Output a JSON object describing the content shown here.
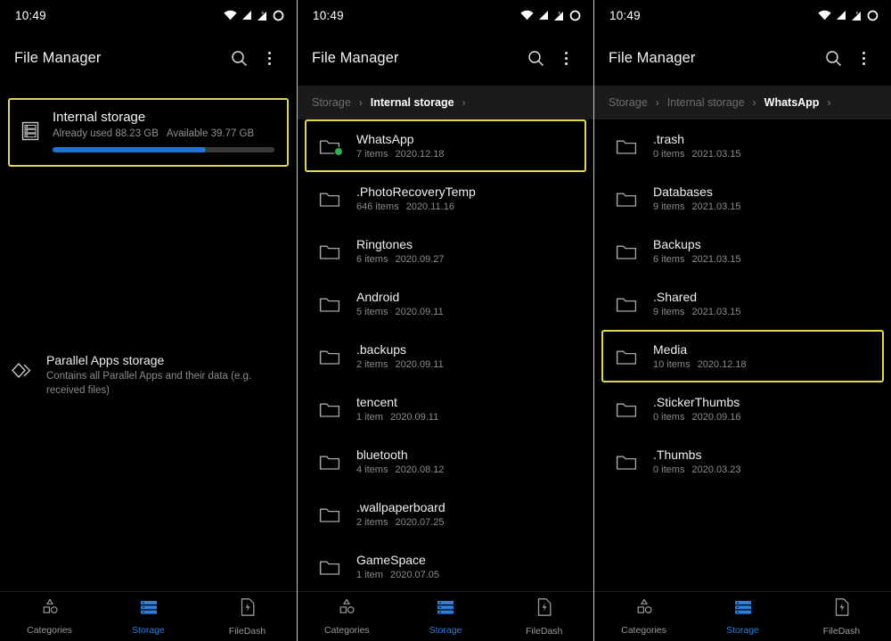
{
  "statusbar": {
    "time": "10:49",
    "icons": [
      "wifi-icon",
      "signal-icon",
      "signal-x-icon",
      "battery-circle-icon"
    ]
  },
  "appbar": {
    "title": "File Manager",
    "search_icon": "search-icon",
    "overflow_icon": "more-vertical-icon"
  },
  "colors": {
    "accent_blue": "#1e74d4",
    "highlight_yellow": "#e2d84e",
    "badge_green": "#2fae54",
    "background": "#000000",
    "breadcrumb_bg": "#1b1b1b"
  },
  "bottom_nav": {
    "items": [
      {
        "label": "Categories",
        "icon": "shapes-icon",
        "active": false
      },
      {
        "label": "Storage",
        "icon": "storage-stack-icon",
        "active": true
      },
      {
        "label": "FileDash",
        "icon": "file-lightning-icon",
        "active": false
      }
    ]
  },
  "panel1": {
    "storage_card": {
      "title": "Internal storage",
      "used_label": "Already used 88.23 GB",
      "available_label": "Available 39.77 GB",
      "progress_percent": 69,
      "icon": "internal-storage-icon",
      "selected": true
    },
    "parallel_apps": {
      "title": "Parallel Apps storage",
      "description": "Contains all Parallel Apps and their data (e.g. received files)",
      "icon": "parallel-apps-icon"
    }
  },
  "panel2": {
    "breadcrumb": [
      {
        "label": "Storage",
        "active": false
      },
      {
        "label": "Internal storage",
        "active": true
      }
    ],
    "files": [
      {
        "name": "WhatsApp",
        "items": "7 items",
        "date": "2020.12.18",
        "selected": true,
        "badge": true
      },
      {
        "name": ".PhotoRecoveryTemp",
        "items": "646 items",
        "date": "2020.11.16",
        "selected": false,
        "badge": false
      },
      {
        "name": "Ringtones",
        "items": "6 items",
        "date": "2020.09.27",
        "selected": false,
        "badge": false
      },
      {
        "name": "Android",
        "items": "5 items",
        "date": "2020.09.11",
        "selected": false,
        "badge": false
      },
      {
        "name": ".backups",
        "items": "2 items",
        "date": "2020.09.11",
        "selected": false,
        "badge": false
      },
      {
        "name": "tencent",
        "items": "1 item",
        "date": "2020.09.11",
        "selected": false,
        "badge": false
      },
      {
        "name": "bluetooth",
        "items": "4 items",
        "date": "2020.08.12",
        "selected": false,
        "badge": false
      },
      {
        "name": ".wallpaperboard",
        "items": "2 items",
        "date": "2020.07.25",
        "selected": false,
        "badge": false
      },
      {
        "name": "GameSpace",
        "items": "1 item",
        "date": "2020.07.05",
        "selected": false,
        "badge": false
      }
    ]
  },
  "panel3": {
    "breadcrumb": [
      {
        "label": "Storage",
        "active": false
      },
      {
        "label": "Internal storage",
        "active": false
      },
      {
        "label": "WhatsApp",
        "active": true
      }
    ],
    "files": [
      {
        "name": ".trash",
        "items": "0 items",
        "date": "2021.03.15",
        "selected": false,
        "badge": false
      },
      {
        "name": "Databases",
        "items": "9 items",
        "date": "2021.03.15",
        "selected": false,
        "badge": false
      },
      {
        "name": "Backups",
        "items": "6 items",
        "date": "2021.03.15",
        "selected": false,
        "badge": false
      },
      {
        "name": ".Shared",
        "items": "9 items",
        "date": "2021.03.15",
        "selected": false,
        "badge": false
      },
      {
        "name": "Media",
        "items": "10 items",
        "date": "2020.12.18",
        "selected": true,
        "badge": false
      },
      {
        "name": ".StickerThumbs",
        "items": "0 items",
        "date": "2020.09.16",
        "selected": false,
        "badge": false
      },
      {
        "name": ".Thumbs",
        "items": "0 items",
        "date": "2020.03.23",
        "selected": false,
        "badge": false
      }
    ]
  }
}
